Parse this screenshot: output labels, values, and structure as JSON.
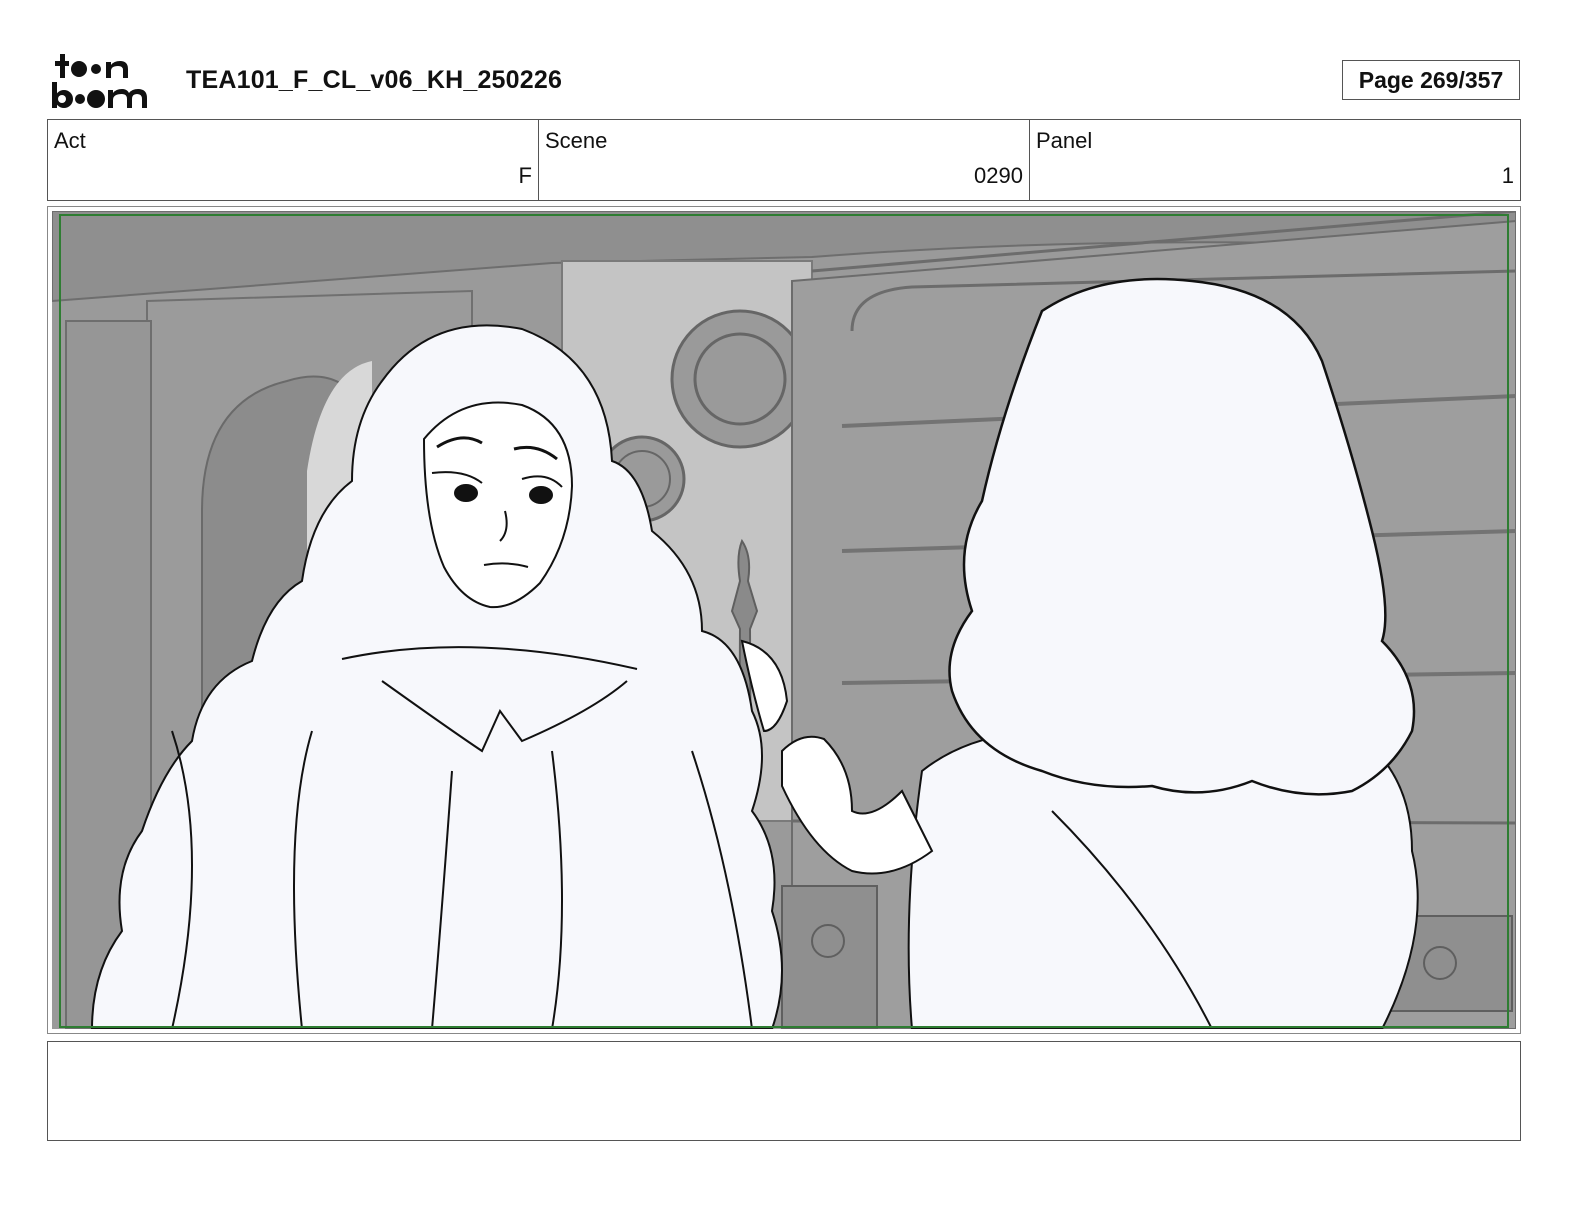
{
  "header": {
    "logo_text": "toon boom",
    "document_title": "TEA101_F_CL_v06_KH_250226",
    "page_indicator": "Page 269/357"
  },
  "info": {
    "act": {
      "label": "Act",
      "value": "F"
    },
    "scene": {
      "label": "Scene",
      "value": "0290"
    },
    "panel": {
      "label": "Panel",
      "value": "1"
    }
  },
  "panel_image": {
    "safe_frame_color": "#2e7d32",
    "background_tone": "#9a9a9a"
  },
  "notes": {
    "text": ""
  }
}
